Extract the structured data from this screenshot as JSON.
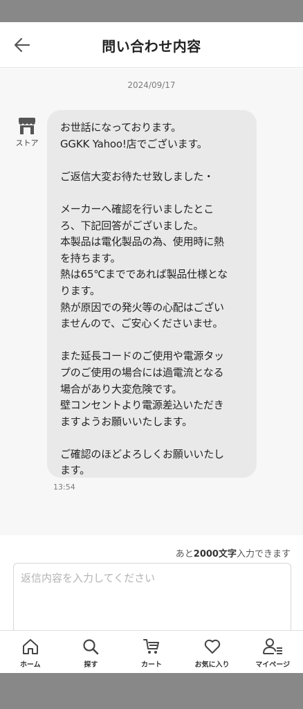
{
  "header": {
    "title": "問い合わせ内容",
    "back_icon": "arrow-left-icon"
  },
  "chat": {
    "date": "2024/09/17",
    "store_label": "ストア",
    "message": "お世話になっております。\nGGKK Yahoo!店でございます。\n\nご返信大変お待たせ致しました・\n\nメーカーへ確認を行いましたとこ\nろ、下記回答がございました。\n本製品は電化製品の為、使用時に熱\nを持ちます。\n熱は65℃までであれば製品仕様とな\nります。\n熱が原因での発火等の心配はござい\nませんので、ご安心くださいませ。\n\nまた延長コードのご使用や電源タッ\nプのご使用の場合には過電流となる\n場合があり大変危険です。\n壁コンセントより電源差込いただき\nますようお願いいたします。\n\nご確認のほどよろしくお願いいたし\nます。",
    "time": "13:54"
  },
  "reply": {
    "count_prefix": "あと",
    "count_value": "2000文字",
    "count_suffix": "入力できます",
    "placeholder": "返信内容を入力してください"
  },
  "tabs": [
    {
      "label": "ホーム",
      "icon": "home-icon"
    },
    {
      "label": "探す",
      "icon": "search-icon"
    },
    {
      "label": "カート",
      "icon": "cart-icon"
    },
    {
      "label": "お気に入り",
      "icon": "heart-icon"
    },
    {
      "label": "マイページ",
      "icon": "user-icon"
    }
  ],
  "colors": {
    "system_bar": "#888888",
    "chat_background": "#f7f7f7",
    "bubble": "#e9e9e9",
    "icon": "#555555"
  }
}
